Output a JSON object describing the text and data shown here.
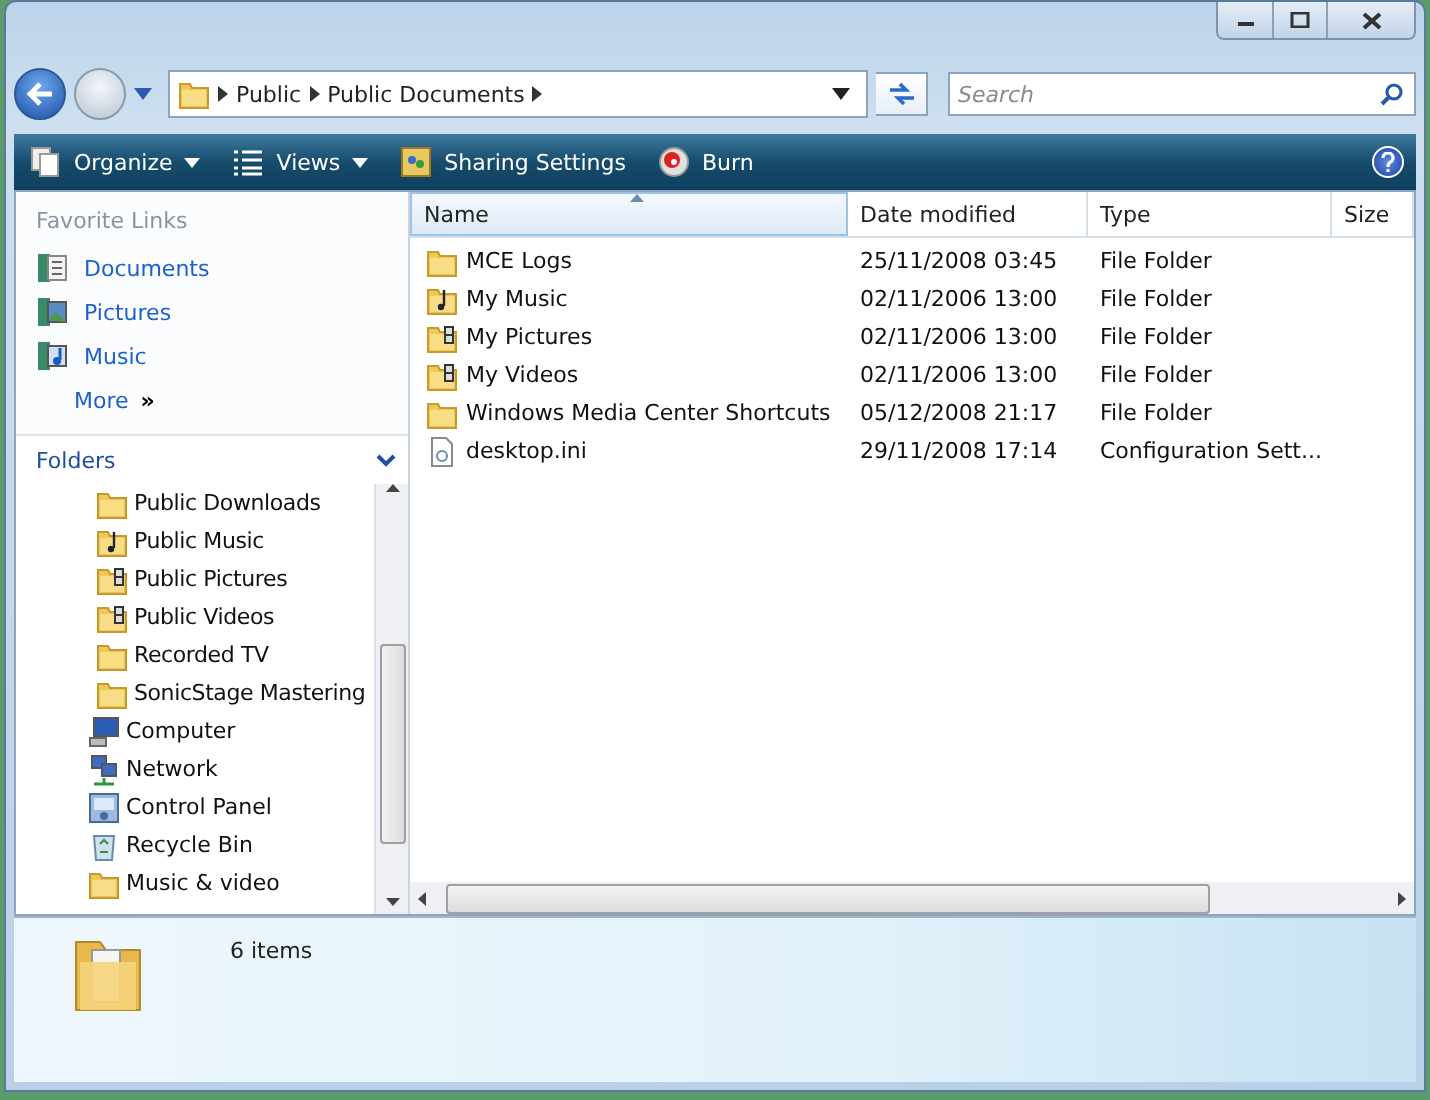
{
  "address_bar": {
    "segments": [
      "Public",
      "Public Documents"
    ]
  },
  "search": {
    "placeholder": "Search"
  },
  "toolbar": {
    "buttons": [
      {
        "label": "Organize",
        "kind": "organize",
        "dropdown": true
      },
      {
        "label": "Views",
        "kind": "views",
        "dropdown": true
      },
      {
        "label": "Sharing Settings",
        "kind": "sharing",
        "dropdown": false
      },
      {
        "label": "Burn",
        "kind": "burn",
        "dropdown": false
      }
    ]
  },
  "favorite_links": {
    "title": "Favorite Links",
    "items": [
      {
        "label": "Documents",
        "kind": "documents"
      },
      {
        "label": "Pictures",
        "kind": "pictures"
      },
      {
        "label": "Music",
        "kind": "music"
      }
    ],
    "more": {
      "label": "More",
      "glyph": "»"
    }
  },
  "folders": {
    "title": "Folders",
    "nested_items": [
      {
        "label": "Public Downloads",
        "kind": "folder"
      },
      {
        "label": "Public Music",
        "kind": "music-folder"
      },
      {
        "label": "Public Pictures",
        "kind": "media-folder"
      },
      {
        "label": "Public Videos",
        "kind": "media-folder"
      },
      {
        "label": "Recorded TV",
        "kind": "folder"
      },
      {
        "label": "SonicStage Mastering",
        "kind": "folder"
      }
    ],
    "items": [
      {
        "label": "Computer",
        "kind": "computer"
      },
      {
        "label": "Network",
        "kind": "network"
      },
      {
        "label": "Control Panel",
        "kind": "control-panel"
      },
      {
        "label": "Recycle Bin",
        "kind": "recycle-bin"
      },
      {
        "label": "Music & video",
        "kind": "folder"
      }
    ]
  },
  "table": {
    "columns": [
      {
        "label": "Name",
        "sorted": true
      },
      {
        "label": "Date modified",
        "sorted": false
      },
      {
        "label": "Type",
        "sorted": false
      },
      {
        "label": "Size",
        "sorted": false
      }
    ],
    "rows": [
      {
        "name": "MCE Logs",
        "kind": "folder",
        "date": "25/11/2008 03:45",
        "type": "File Folder"
      },
      {
        "name": "My Music",
        "kind": "music-folder",
        "date": "02/11/2006 13:00",
        "type": "File Folder"
      },
      {
        "name": "My Pictures",
        "kind": "media-folder",
        "date": "02/11/2006 13:00",
        "type": "File Folder"
      },
      {
        "name": "My Videos",
        "kind": "media-folder",
        "date": "02/11/2006 13:00",
        "type": "File Folder"
      },
      {
        "name": "Windows Media Center Shortcuts",
        "kind": "folder",
        "date": "05/12/2008 21:17",
        "type": "File Folder"
      },
      {
        "name": "desktop.ini",
        "kind": "file",
        "date": "29/11/2008 17:14",
        "type": "Configuration Sett..."
      }
    ]
  },
  "details_pane": {
    "count": "6 items"
  }
}
